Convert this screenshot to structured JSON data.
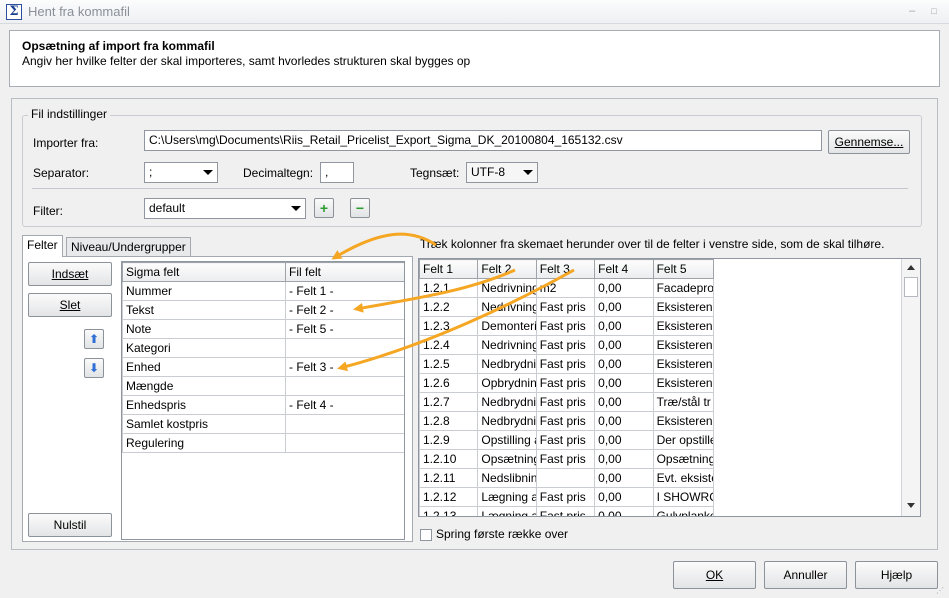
{
  "window": {
    "icon_glyph": "Σ",
    "title": "Hent fra kommafil",
    "minimize_glyph": "–",
    "maximize_glyph": "□"
  },
  "header": {
    "title": "Opsætning af import fra kommafil",
    "subtitle": "Angiv her hvilke felter der skal importeres, samt hvorledes strukturen skal bygges op"
  },
  "file_settings": {
    "legend": "Fil indstillinger",
    "import_label": "Importer fra:",
    "import_path": "C:\\Users\\mg\\Documents\\Riis_Retail_Pricelist_Export_Sigma_DK_20100804_165132.csv",
    "browse_label": "Gennemse...",
    "separator_label": "Separator:",
    "separator_value": ";",
    "decimal_label": "Decimaltegn:",
    "decimal_value": ",",
    "charset_label": "Tegnsæt:",
    "charset_value": "UTF-8",
    "filter_label": "Filter:",
    "filter_value": "default",
    "add_glyph": "+",
    "remove_glyph": "−"
  },
  "tabs": [
    {
      "label": "Felter",
      "active": true
    },
    {
      "label": "Niveau/Undergrupper",
      "active": false
    }
  ],
  "side_buttons": {
    "insert": "Indsæt",
    "delete": "Slet",
    "reset": "Nulstil",
    "up_glyph": "⬆",
    "down_glyph": "⬇"
  },
  "mapping": {
    "headers": [
      "Sigma felt",
      "Fil felt"
    ],
    "rows": [
      {
        "sigma": "Nummer",
        "file": "- Felt 1 -"
      },
      {
        "sigma": "Tekst",
        "file": "- Felt 2 -"
      },
      {
        "sigma": "Note",
        "file": "- Felt 5 -"
      },
      {
        "sigma": "Kategori",
        "file": ""
      },
      {
        "sigma": "Enhed",
        "file": "- Felt 3 -"
      },
      {
        "sigma": "Mængde",
        "file": ""
      },
      {
        "sigma": "Enhedspris",
        "file": "- Felt 4 -"
      },
      {
        "sigma": "Samlet kostpris",
        "file": ""
      },
      {
        "sigma": "Regulering",
        "file": ""
      }
    ]
  },
  "preview": {
    "instruction": "Træk kolonner fra skemaet herunder over til de felter i venstre side, som de skal tilhøre.",
    "headers": [
      "Felt 1",
      "Felt 2",
      "Felt 3",
      "Felt 4",
      "Felt 5"
    ],
    "rows": [
      [
        "1.2.1",
        "Nedrivning",
        "m2",
        "0,00",
        "Facadepro"
      ],
      [
        "1.2.2",
        "Nedrivning",
        "Fast pris",
        "0,00",
        "Eksisteren"
      ],
      [
        "1.2.3",
        "Demonteri",
        "Fast pris",
        "0,00",
        "Eksisteren"
      ],
      [
        "1.2.4",
        "Nedrivning",
        "Fast pris",
        "0,00",
        "Eksisteren"
      ],
      [
        "1.2.5",
        "Nedbrydnir",
        "Fast pris",
        "0,00",
        "Eksisteren"
      ],
      [
        "1.2.6",
        "Opbrydnin",
        "Fast pris",
        "0,00",
        "Eksisteren"
      ],
      [
        "1.2.7",
        "Nedbrydnir",
        "Fast pris",
        "0,00",
        "Træ/stål tr"
      ],
      [
        "1.2.8",
        "Nedbrydnir",
        "Fast pris",
        "0,00",
        "Eksisteren"
      ],
      [
        "1.2.9",
        "Opstilling a",
        "Fast pris",
        "0,00",
        "Der opstille"
      ],
      [
        "1.2.10",
        "Opsætning",
        "Fast pris",
        "0,00",
        "Opsætning"
      ],
      [
        "1.2.11",
        "Nedslibnin",
        "",
        "0,00",
        "Evt. eksiste"
      ],
      [
        "1.2.12",
        "Lægning a",
        "Fast pris",
        "0,00",
        "I SHOWRC"
      ],
      [
        "1.2.13",
        "Lægning a",
        "Fast pris",
        "0,00",
        "Gulvplanke"
      ]
    ],
    "skip_first_row_label": "Spring første række over"
  },
  "footer": {
    "ok": "OK",
    "cancel": "Annuller",
    "help": "Hjælp"
  },
  "colors": {
    "arrow": "#f5a623",
    "add_icon": "#2e9c2e",
    "nav_icon": "#2f6fd6"
  }
}
